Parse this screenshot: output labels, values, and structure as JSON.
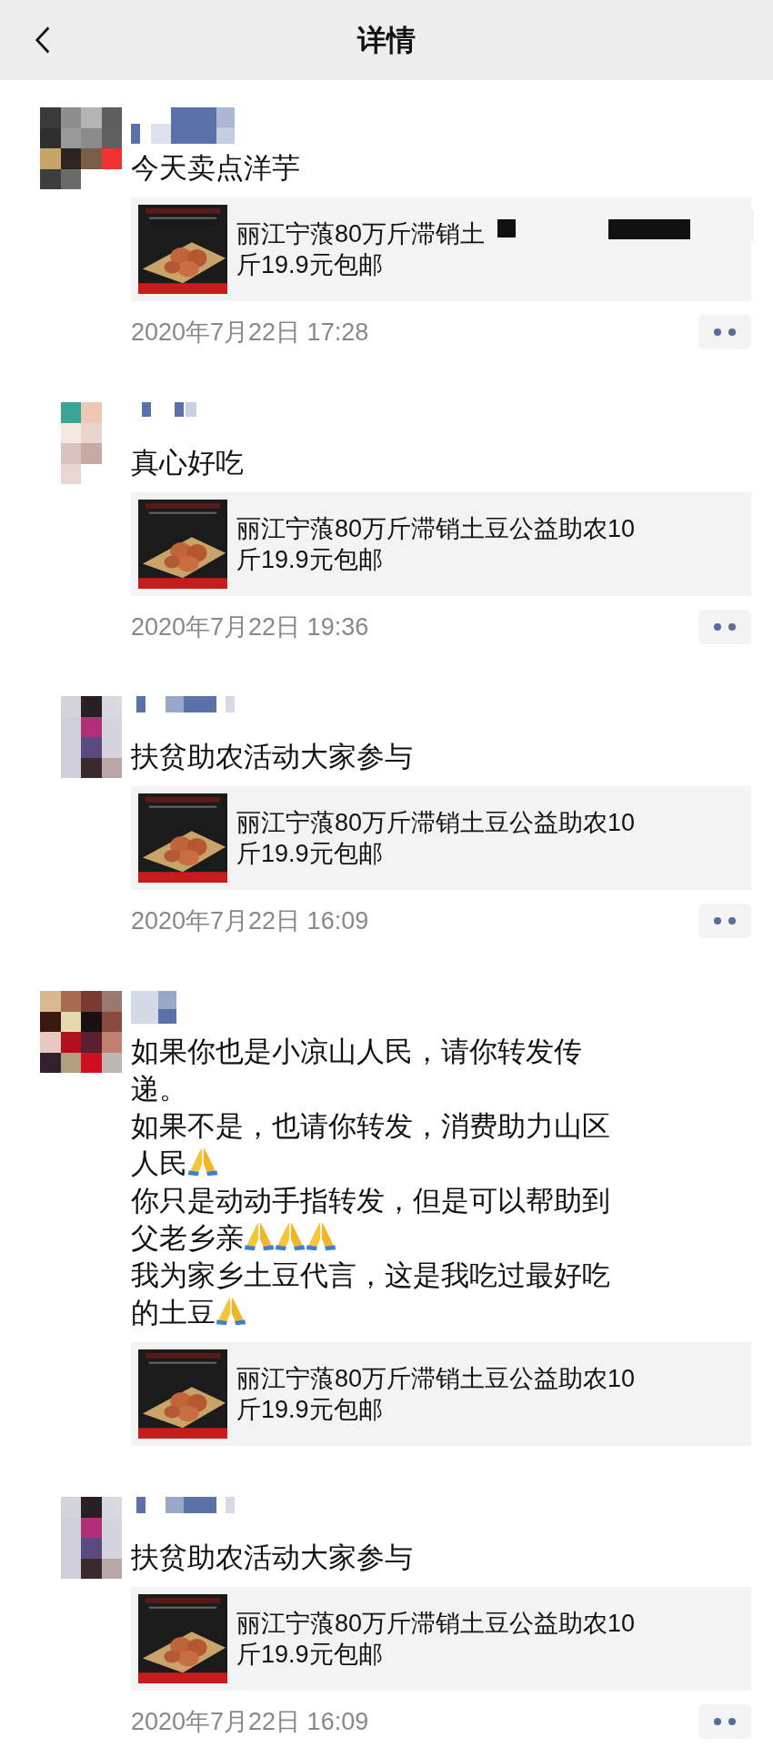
{
  "header": {
    "title": "详情"
  },
  "posts": [
    {
      "body": [
        [
          {
            "kind": "text",
            "text": "今天卖点洋芋"
          }
        ]
      ],
      "link": {
        "lines": [
          "丽江宁蒗80万斤滞销土",
          "斤19.9元包邮"
        ],
        "redacted": true
      },
      "date": "2020年7月22日 17:28"
    },
    {
      "body": [
        [
          {
            "kind": "text",
            "text": "真心好吃"
          }
        ]
      ],
      "link": {
        "lines": [
          "丽江宁蒗80万斤滞销土豆公益助农10",
          "斤19.9元包邮"
        ],
        "redacted": false
      },
      "date": "2020年7月22日 19:36"
    },
    {
      "body": [
        [
          {
            "kind": "text",
            "text": "扶贫助农活动大家参与"
          }
        ]
      ],
      "link": {
        "lines": [
          "丽江宁蒗80万斤滞销土豆公益助农10",
          "斤19.9元包邮"
        ],
        "redacted": false
      },
      "date": "2020年7月22日 16:09"
    },
    {
      "body": [
        [
          {
            "kind": "text",
            "text": "如果你也是小凉山人民，请你转发传递。"
          }
        ],
        [
          {
            "kind": "text",
            "text": "如果不是，也请你转发，消费助力山区人民"
          },
          {
            "kind": "praying-hands"
          }
        ],
        [
          {
            "kind": "text",
            "text": "你只是动动手指转发，但是可以帮助到父老乡亲"
          },
          {
            "kind": "praying-hands"
          },
          {
            "kind": "praying-hands"
          },
          {
            "kind": "praying-hands"
          }
        ],
        [
          {
            "kind": "text",
            "text": "我为家乡土豆代言，这是我吃过最好吃的土豆"
          },
          {
            "kind": "praying-hands"
          }
        ]
      ],
      "link": {
        "lines": [
          "丽江宁蒗80万斤滞销土豆公益助农10",
          "斤19.9元包邮"
        ],
        "redacted": false
      }
    },
    {
      "body": [
        [
          {
            "kind": "text",
            "text": "扶贫助农活动大家参与"
          }
        ]
      ],
      "link": {
        "lines": [
          "丽江宁蒗80万斤滞销土豆公益助农10",
          "斤19.9元包邮"
        ],
        "redacted": false
      },
      "date": "2020年7月22日 16:09"
    }
  ]
}
